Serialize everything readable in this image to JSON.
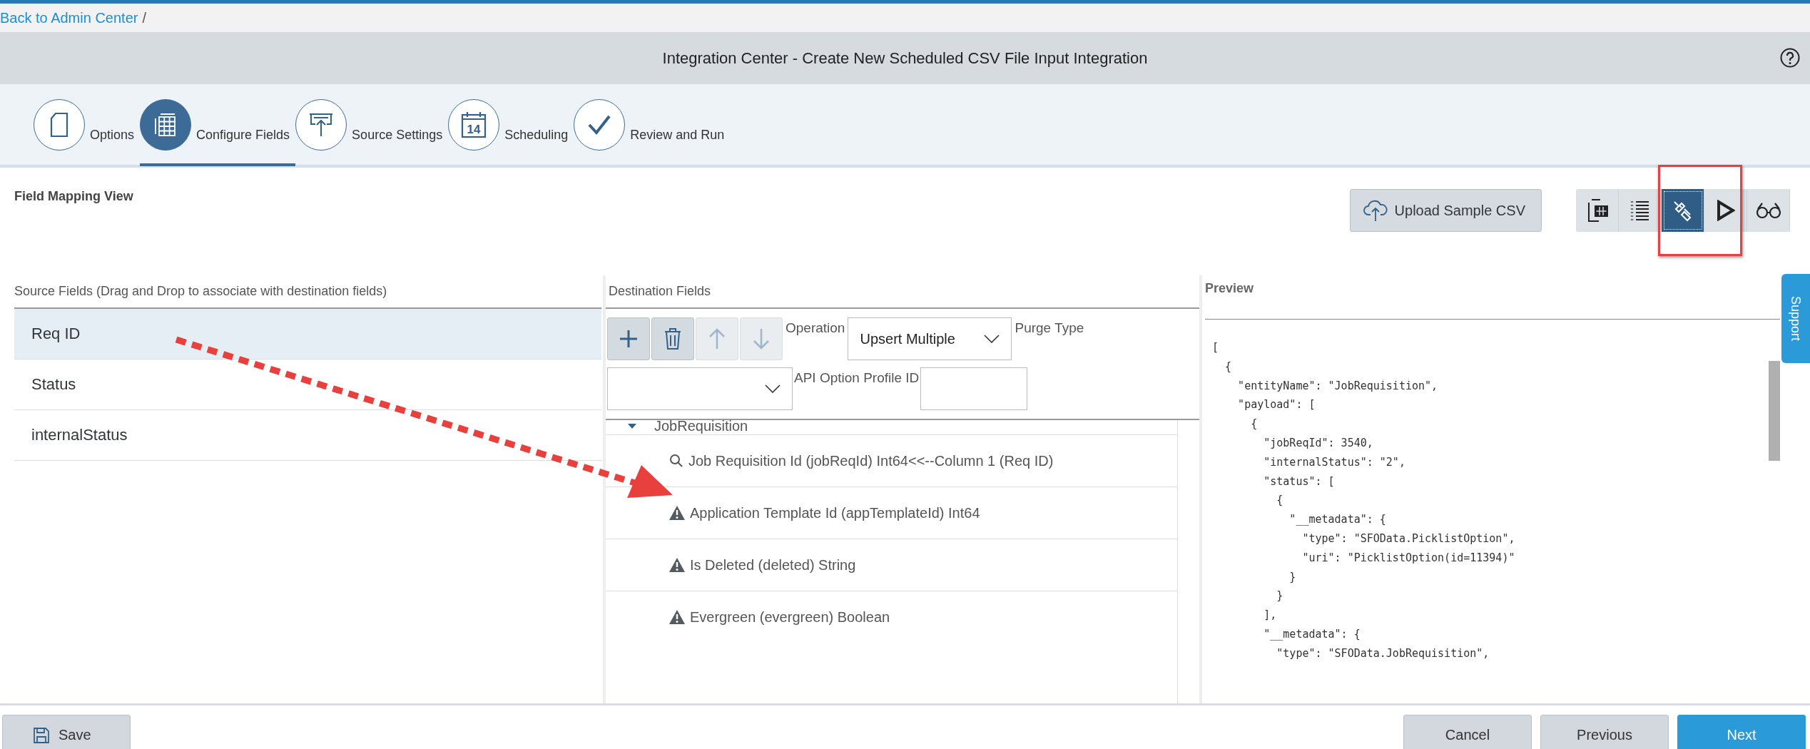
{
  "breadcrumb": {
    "link": "Back to Admin Center",
    "separator": "/"
  },
  "title": "Integration Center - Create New Scheduled CSV File Input Integration",
  "steps": [
    {
      "label": "Options",
      "kind": "document",
      "selected": false
    },
    {
      "label": "Configure Fields",
      "kind": "grid",
      "selected": true
    },
    {
      "label": "Source Settings",
      "kind": "upload",
      "selected": false
    },
    {
      "label": "Scheduling",
      "kind": "calendar",
      "selected": false,
      "icon_text": "14"
    },
    {
      "label": "Review and Run",
      "kind": "check",
      "selected": false
    }
  ],
  "view_title": "Field Mapping View",
  "upload_button": "Upload Sample CSV",
  "view_buttons": [
    {
      "kind": "table",
      "selected": false
    },
    {
      "kind": "list",
      "selected": false
    },
    {
      "kind": "plug",
      "selected": true
    },
    {
      "kind": "play",
      "selected": false
    },
    {
      "kind": "glasses",
      "selected": false
    }
  ],
  "source": {
    "heading": "Source Fields (Drag and Drop to associate with destination fields)",
    "rows": [
      {
        "label": "Req ID",
        "selected": true
      },
      {
        "label": "Status",
        "selected": false
      },
      {
        "label": "internalStatus",
        "selected": false
      }
    ]
  },
  "destination": {
    "heading": "Destination Fields",
    "operation_label": "Operation",
    "operation_value": "Upsert Multiple",
    "purge_label": "Purge Type",
    "api_label": "API Option Profile ID",
    "tree": {
      "label": "JobRequisition",
      "expanded": true,
      "children": [
        {
          "label": "Job Requisition Id (jobReqId) Int64<<--Column 1 (Req ID)",
          "kind": "mapped"
        },
        {
          "label": "Application Template Id (appTemplateId) Int64",
          "kind": "warning"
        },
        {
          "label": "Is Deleted (deleted) String",
          "kind": "warning"
        },
        {
          "label": "Evergreen (evergreen) Boolean",
          "kind": "warning"
        }
      ]
    }
  },
  "preview": {
    "heading": "Preview",
    "lines": [
      "[",
      "  {",
      "    \"entityName\": \"JobRequisition\",",
      "    \"payload\": [",
      "      {",
      "        \"jobReqId\": 3540,",
      "        \"internalStatus\": \"2\",",
      "        \"status\": [",
      "          {",
      "            \"__metadata\": {",
      "              \"type\": \"SFOData.PicklistOption\",",
      "              \"uri\": \"PicklistOption(id=11394)\"",
      "            }",
      "          }",
      "        ],",
      "        \"__metadata\": {",
      "          \"type\": \"SFOData.JobRequisition\","
    ]
  },
  "support_tab": "Support",
  "footer": {
    "save": "Save",
    "cancel": "Cancel",
    "previous": "Previous",
    "next": "Next"
  }
}
